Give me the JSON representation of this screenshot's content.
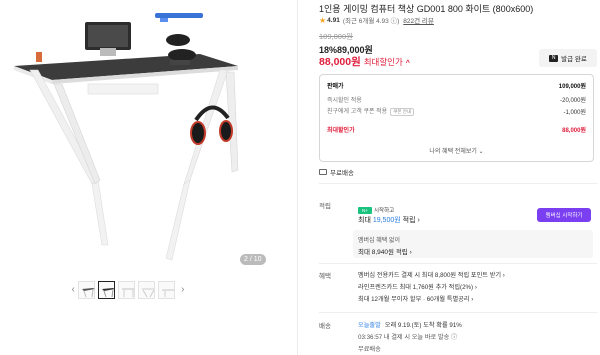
{
  "gallery": {
    "counter": "2 / 10",
    "thumbs": [
      "thumb-1",
      "thumb-2",
      "thumb-3",
      "thumb-4",
      "thumb-5"
    ],
    "prev_icon": "‹",
    "next_icon": "›"
  },
  "product": {
    "title": "1인용 게이밍 컴퓨터 책상 GD001 800 화이트 (800x600)",
    "star": "★",
    "score": "4.91",
    "rating_meta": "(최근 6개월 4.93 ⓘ)",
    "reviews": "822건 리뷰"
  },
  "price": {
    "original": "109,000원",
    "discounted": "18%89,000원",
    "final_amount": "88,000원",
    "final_label": "최대할인가",
    "final_chevron": "^",
    "coupon_button": "발급 완료",
    "coupon_icon": "N"
  },
  "price_box": {
    "rows": [
      {
        "k": "판매가",
        "v": "109,000원"
      },
      {
        "k": "즉시할인 적용",
        "v": "-20,000원"
      },
      {
        "k": "친구에게 고객 쿠폰 적용",
        "chip": "쿠폰 안내",
        "v": "-1,000원"
      },
      {
        "k": "최대할인가",
        "v": "88,000원"
      }
    ],
    "view_all": "나의 혜택 전체보기 ⌄"
  },
  "shipping": {
    "free": "무료배송"
  },
  "points": {
    "label": "적립",
    "badge": "N+",
    "badge_text": "시작하고",
    "main_prefix": "최대 ",
    "main_amount": "19,500원",
    "main_suffix": " 적립 ›",
    "membership_button": "멤버십 시작하기",
    "member_line1": "멤버십 혜택 없이",
    "member_line2": "최대 8,940원 적립 ›"
  },
  "benefits": {
    "label": "혜택",
    "lines": [
      "멤버십 전용카드 결제 시 최대 8,800원 적립 포인트 받기 ›",
      "라인프렌즈카드 최대 1,760원 추가 적립(2%) ›",
      "최대 12개월 무이자 할부 · 60개월 특별공리 ›"
    ]
  },
  "delivery": {
    "label": "배송",
    "today_tag": "오늘출발",
    "today_text": "오래 9.19.(토) 도착 확률 91%",
    "line2": "03:36:57   내 결제 시 오늘 바로 발송 ⓘ",
    "line3": "무료배송"
  },
  "colors": {
    "accent_red": "#e01e3c",
    "membership_purple": "#7b3ff2",
    "naver_green": "#19c37d",
    "link_blue": "#2a7de1",
    "star_yellow": "#f5a623"
  }
}
